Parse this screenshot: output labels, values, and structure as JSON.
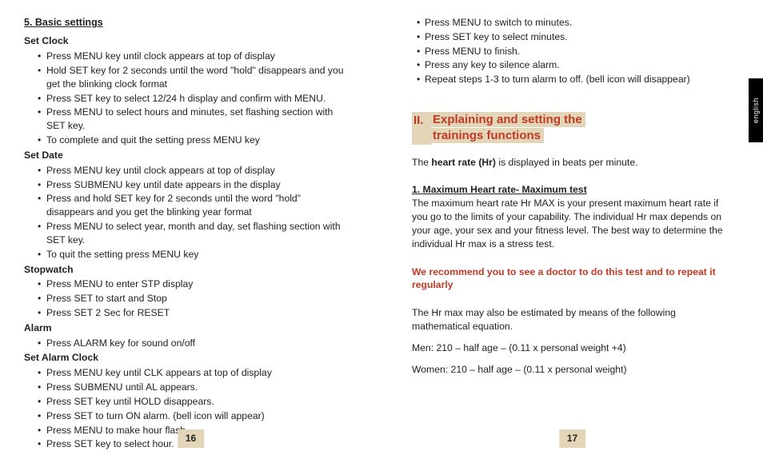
{
  "left": {
    "section_title": "5. Basic settings",
    "groups": [
      {
        "head": "Set Clock",
        "items": [
          "Press MENU key until clock appears at top of display",
          "Hold SET key for 2 seconds until the word \"hold\" disappears and you get the blinking clock format",
          "Press SET key to select 12/24 h display and confirm with MENU.",
          "Press MENU to select hours and minutes, set flashing section with SET key.",
          "To complete and quit the setting press MENU key"
        ]
      },
      {
        "head": "Set Date",
        "items": [
          "Press MENU key until clock appears at top of display",
          "Press SUBMENU key until date appears in the display",
          "Press and hold SET key for 2 seconds until the word \"hold\" disappears and you get the blinking year format",
          "Press MENU to select year, month and day, set flashing section with SET key.",
          "To quit the setting press MENU key"
        ]
      },
      {
        "head": "Stopwatch",
        "items": [
          "Press MENU to enter STP display",
          "Press SET to start and Stop",
          "Press SET 2 Sec for RESET"
        ]
      },
      {
        "head": "Alarm",
        "items": [
          "Press ALARM key for sound on/off"
        ]
      },
      {
        "head": "Set Alarm Clock",
        "items": [
          "Press MENU key until CLK appears at top of display",
          "Press SUBMENU until AL appears.",
          "Press SET key until HOLD disappears.",
          "Press SET to turn ON alarm. (bell icon will appear)",
          "Press MENU to make hour flash.",
          "Press SET key to select hour."
        ]
      }
    ],
    "pagenum": "16"
  },
  "right": {
    "cont_items": [
      "Press MENU to switch to minutes.",
      "Press SET key to select minutes.",
      "Press MENU to finish.",
      "Press any key to silence alarm.",
      "Repeat steps 1-3 to turn alarm to off. (bell icon will disappear)"
    ],
    "roman_num": "II.",
    "roman_title_l1": "Explaining and setting the",
    "roman_title_l2": "trainings functions",
    "hr_pre": "The ",
    "hr_bold": "heart rate (Hr)",
    "hr_post": " is displayed in beats per minute.",
    "max_head": "1. Maximum Heart rate- Maximum test",
    "max_body": "The maximum heart rate Hr MAX is your present maximum heart rate if you go to the limits of your capability. The individual Hr max depends on your age, your sex and your fitness level. The best way to determine the individual Hr max is a stress test.",
    "warn": "We recommend you to see a doctor to do this test and to repeat it regularly",
    "est_intro": "The Hr max may also be estimated by means of the following mathematical equation.",
    "men": "Men: 210 – half age – (0.11 x personal weight +4)",
    "women": "Women: 210 – half age – (0.11 x personal weight)",
    "pagenum": "17",
    "lang": "english"
  }
}
